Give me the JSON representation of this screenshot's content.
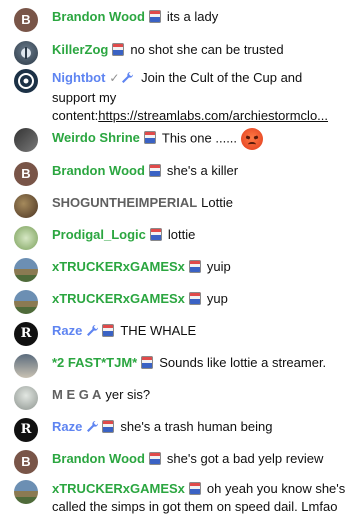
{
  "messages": [
    {
      "author": "Brandon Wood",
      "text": "its a lady",
      "avatar_letter": "B"
    },
    {
      "author": "KillerZog",
      "text": "no shot she can be trusted"
    },
    {
      "author": "Nightbot",
      "text": "Join the Cult of the Cup and support my content:",
      "link": "https://streamlabs.com/archiestormclo..."
    },
    {
      "author": "Weirdo Shrine",
      "text": "This one ......",
      "emoji": "angry-face"
    },
    {
      "author": "Brandon Wood",
      "text": "she's a killer",
      "avatar_letter": "B"
    },
    {
      "author": "SHOGUNTHEIMPERIAL",
      "text": "Lottie"
    },
    {
      "author": "Prodigal_Logic",
      "text": "lottie"
    },
    {
      "author": "xTRUCKERxGAMESx",
      "text": "yuip"
    },
    {
      "author": "xTRUCKERxGAMESx",
      "text": "yup"
    },
    {
      "author": "Raze",
      "text": "THE WHALE",
      "avatar_letter": "R"
    },
    {
      "author": "*2 FAST*TJM*",
      "text": "Sounds like lottie a streamer."
    },
    {
      "author": "M E G A",
      "text": "yer sis?"
    },
    {
      "author": "Raze",
      "text": "she's a trash human being",
      "avatar_letter": "R"
    },
    {
      "author": "Brandon Wood",
      "text": "she's got a bad yelp review",
      "avatar_letter": "B"
    },
    {
      "author": "xTRUCKERxGAMESx",
      "text": "oh yeah you know she's called the simps in got them on speed dail. Lmfao"
    }
  ],
  "colors": {
    "member_green": "#2ba640",
    "moderator_blue": "#5e84f1",
    "regular_gray": "#606060"
  }
}
